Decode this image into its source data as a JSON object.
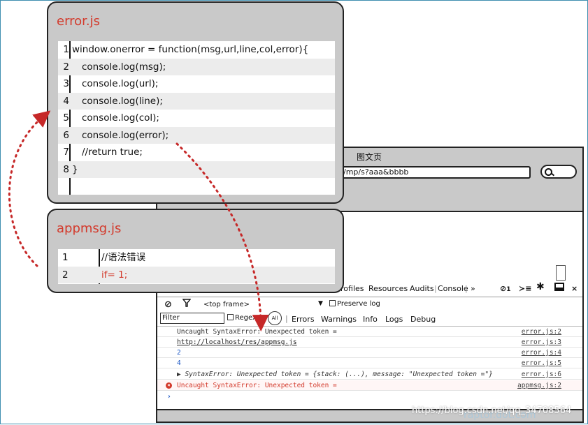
{
  "error_panel": {
    "title": "error.js",
    "lines": [
      {
        "num": "1",
        "code": "window.onerror = function(msg,url,line,col,error){"
      },
      {
        "num": "2",
        "code": "console.log(msg);"
      },
      {
        "num": "3",
        "code": "console.log(url);"
      },
      {
        "num": "4",
        "code": "console.log(line);"
      },
      {
        "num": "5",
        "code": "console.log(col);"
      },
      {
        "num": "6",
        "code": "console.log(error);"
      },
      {
        "num": "7",
        "code": "//return true;"
      },
      {
        "num": "8",
        "code": "}"
      }
    ]
  },
  "appmsg_panel": {
    "title": "appmsg.js",
    "lines": [
      {
        "num": "1",
        "code": "//语法错误"
      },
      {
        "num": "2",
        "code": "if= 1;"
      }
    ]
  },
  "browser": {
    "title": "图文页",
    "url": "/mp/s?aaa&bbbb"
  },
  "devtools": {
    "tabs": [
      "rofiles",
      "Resources",
      "Audits",
      "Console",
      "»"
    ],
    "toolbar_icons": {
      "errors_count": "1",
      "console_prompt": "≻≡",
      "settings": "gear",
      "dock": "dock",
      "close": "×"
    },
    "frame_select": "<top frame>",
    "preserve_log": "Preserve log",
    "filter_placeholder": "Filter",
    "regex_label": "Regex",
    "all_label": "All",
    "levels": [
      "Errors",
      "Warnings",
      "Info",
      "Logs",
      "Debug"
    ],
    "console": [
      {
        "msg": "Uncaught SyntaxError: Unexpected token =",
        "src": "error.js:2",
        "kind": "log"
      },
      {
        "msg": "http://localhost/res/appmsg.js",
        "src": "error.js:3",
        "kind": "link"
      },
      {
        "msg": "2",
        "src": "error.js:4",
        "kind": "num"
      },
      {
        "msg": "4",
        "src": "error.js:5",
        "kind": "num"
      },
      {
        "msg": "▶ SyntaxError: Unexpected token = {stack: (...), message: \"Unexpected token =\"}",
        "src": "error.js:6",
        "kind": "obj"
      },
      {
        "msg": "Uncaught SyntaxError: Unexpected token =",
        "src": "appmsg.js:2",
        "kind": "error"
      }
    ],
    "prompt": "›"
  },
  "watermark": "https://blog.csdn.net/qq_34708564",
  "watermark2": "raptor.dot.com",
  "colors": {
    "accent_red": "#d33a2c",
    "arrow_red": "#c62828",
    "link_blue": "#1a56c4"
  }
}
